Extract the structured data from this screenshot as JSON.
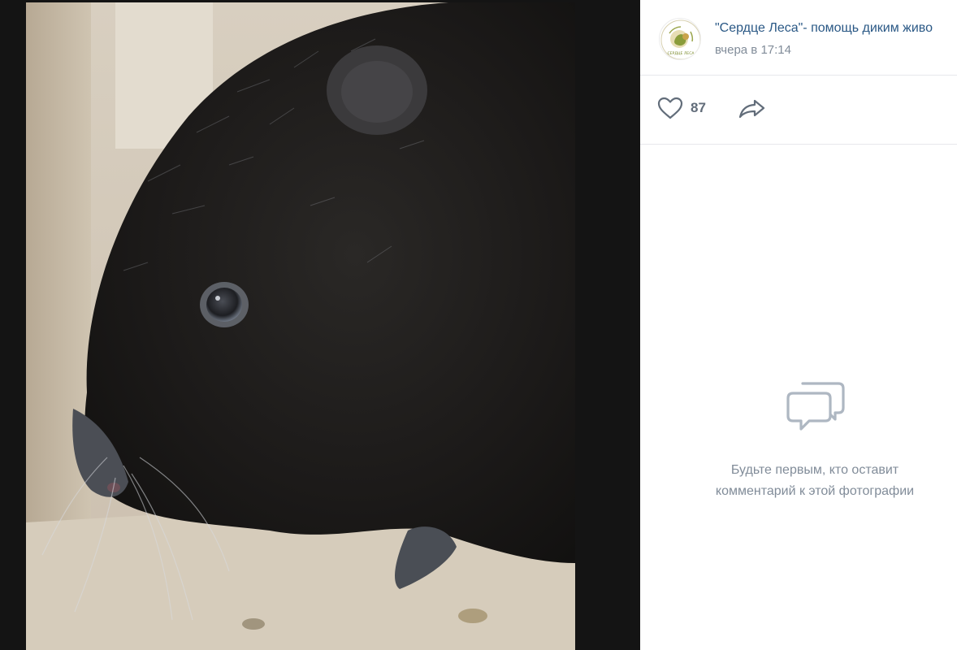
{
  "author": {
    "name": "\"Сердце Леса\"- помощь диким живо",
    "date": "вчера в 17:14",
    "avatar_caption": "СЕРДЦЕ ЛЕСА"
  },
  "actions": {
    "likes_count": "87"
  },
  "comments": {
    "empty_line1": "Будьте первым, кто оставит",
    "empty_line2": "комментарий к этой фотографии"
  },
  "colors": {
    "link": "#2a5885",
    "muted": "#818c99",
    "icon": "#626d7a",
    "dark_backdrop": "#141414"
  },
  "icons": {
    "like": "heart-outline-icon",
    "share": "share-arrow-icon",
    "empty_comments": "speech-bubbles-icon"
  }
}
